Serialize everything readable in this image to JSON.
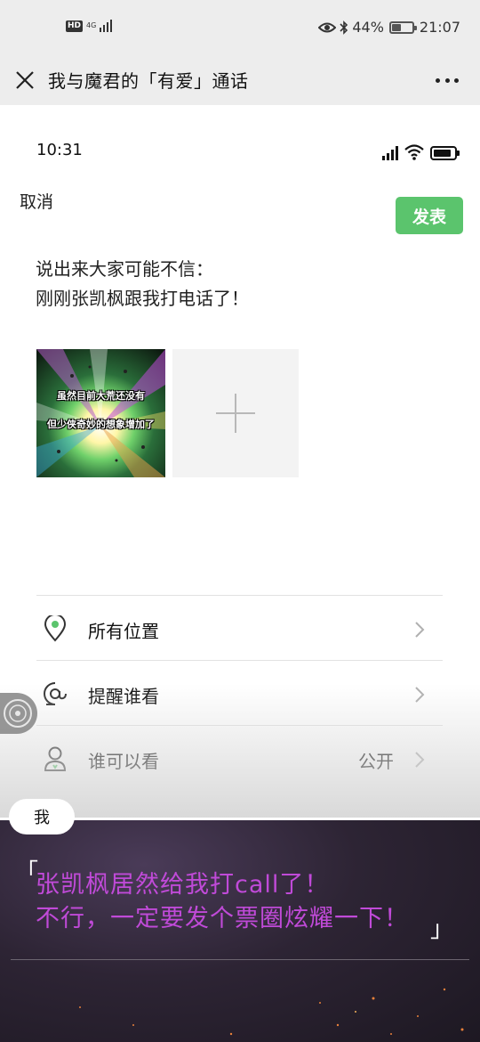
{
  "system_status": {
    "hd_badge": "HD",
    "network": "4G",
    "battery_percent": "44%",
    "battery_level": 0.44,
    "time": "21:07"
  },
  "header": {
    "title": "我与魔君的「有爱」通话",
    "close_icon": "close-icon",
    "more_icon": "more-dots-icon"
  },
  "inner_phone": {
    "time": "10:31",
    "signal_icon": "signal-icon",
    "wifi_icon": "wifi-icon",
    "battery_icon": "battery-icon"
  },
  "compose": {
    "cancel_label": "取消",
    "publish_label": "发表",
    "text_lines": [
      "说出来大家可能不信：",
      "刚刚张凯枫跟我打电话了！"
    ],
    "photo_caption_lines": [
      "虽然目前大荒还没有",
      "但少侠奇妙的想象增加了"
    ],
    "add_photo_icon": "plus-icon"
  },
  "menu": [
    {
      "label": "所有位置",
      "value": "",
      "icon": "location-pin-icon"
    },
    {
      "label": "提醒谁看",
      "value": "",
      "icon": "at-mention-icon"
    },
    {
      "label": "谁可以看",
      "value": "公开",
      "icon": "person-icon"
    }
  ],
  "dialog": {
    "speaker": "我",
    "quote_open": "「",
    "quote_close": "」",
    "lines": [
      "张凯枫居然给我打call了！",
      "不行，一定要发个票圈炫耀一下！"
    ]
  },
  "colors": {
    "publish_green": "#5bc46d",
    "dialog_text": "#c04ad8",
    "page_bg": "#ededed"
  }
}
